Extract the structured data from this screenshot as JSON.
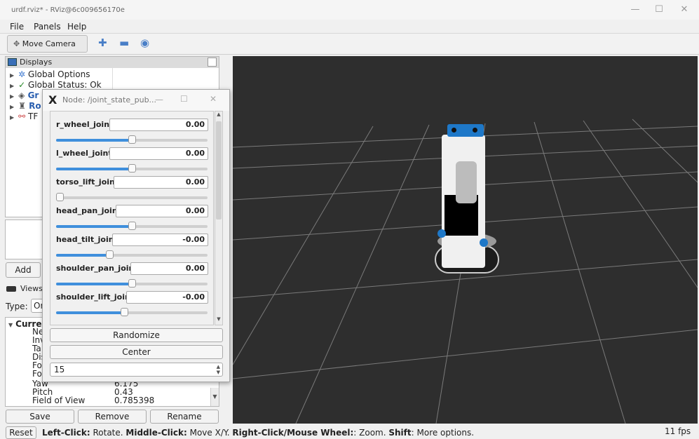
{
  "window": {
    "title": "urdf.rviz* - RViz@6c009656170e"
  },
  "menu": [
    "File",
    "Panels",
    "Help"
  ],
  "toolbar": {
    "move_camera": "Move Camera"
  },
  "displays": {
    "title": "Displays",
    "items": [
      {
        "label": "Global Options",
        "icon": "gear-icon"
      },
      {
        "label": "Global Status: Ok",
        "icon": "check-icon"
      },
      {
        "label": "Gr",
        "icon": "grid-icon",
        "color": "#2a5fb0"
      },
      {
        "label": "Ro",
        "icon": "robot-icon",
        "color": "#2a5fb0"
      },
      {
        "label": "TF",
        "icon": "tf-icon"
      }
    ]
  },
  "add_button": "Add",
  "views": {
    "title": "Views",
    "type_label": "Type:",
    "type_value": "Or",
    "current_label": "Curre",
    "rows": [
      {
        "name": "Ne",
        "value": ""
      },
      {
        "name": "Inv",
        "value": ""
      },
      {
        "name": "Ta",
        "value": ""
      },
      {
        "name": "Dis",
        "value": ""
      },
      {
        "name": "Fo",
        "value": ""
      },
      {
        "name": "Fo",
        "value": ""
      },
      {
        "name": "Yaw",
        "value": "6.175"
      },
      {
        "name": "Pitch",
        "value": "0.43"
      },
      {
        "name": "Field of View",
        "value": "0.785398"
      }
    ],
    "buttons": {
      "save": "Save",
      "remove": "Remove",
      "rename": "Rename"
    }
  },
  "status": {
    "reset": "Reset",
    "left_click_b": "Left-Click:",
    "left_click_t": " Rotate. ",
    "middle_click_b": "Middle-Click:",
    "middle_click_t": " Move X/Y. ",
    "right_click_b": "Right-Click/Mouse Wheel:",
    "right_click_t": ": Zoom. ",
    "shift_b": "Shift",
    "shift_t": ": More options.",
    "fps": "11 fps"
  },
  "dialog": {
    "title": "Node: /joint_state_pub...",
    "joints": [
      {
        "name": "r_wheel_joint",
        "value": "0.00",
        "slider": 0.5
      },
      {
        "name": "l_wheel_joint",
        "value": "0.00",
        "slider": 0.5
      },
      {
        "name": "torso_lift_joint",
        "value": "0.00",
        "slider": 0.02
      },
      {
        "name": "head_pan_joint",
        "value": "0.00",
        "slider": 0.5
      },
      {
        "name": "head_tilt_joint",
        "value": "-0.00",
        "slider": 0.35
      },
      {
        "name": "shoulder_pan_joint",
        "value": "0.00",
        "slider": 0.5
      },
      {
        "name": "shoulder_lift_joint",
        "value": "-0.00",
        "slider": 0.45
      }
    ],
    "randomize": "Randomize",
    "center": "Center",
    "spin_value": "15"
  }
}
